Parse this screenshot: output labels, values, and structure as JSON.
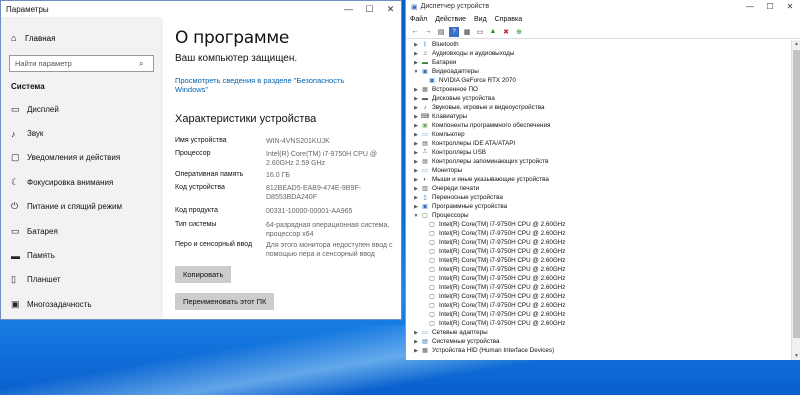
{
  "settings": {
    "window_title": "Параметры",
    "sidebar": {
      "home": "Главная",
      "search_placeholder": "Найти параметр",
      "group": "Система",
      "items": [
        {
          "label": "Дисплей",
          "icon": "display-icon"
        },
        {
          "label": "Звук",
          "icon": "sound-icon"
        },
        {
          "label": "Уведомления и действия",
          "icon": "notifications-icon"
        },
        {
          "label": "Фокусировка внимания",
          "icon": "focus-assist-icon"
        },
        {
          "label": "Питание и спящий режим",
          "icon": "power-icon"
        },
        {
          "label": "Батарея",
          "icon": "battery-icon"
        },
        {
          "label": "Память",
          "icon": "storage-icon"
        },
        {
          "label": "Планшет",
          "icon": "tablet-icon"
        },
        {
          "label": "Многозадачность",
          "icon": "multitasking-icon"
        }
      ]
    },
    "main": {
      "title": "О программе",
      "protected": "Ваш компьютер защищен.",
      "security_link": "Просмотреть сведения в разделе \"Безопасность Windows\"",
      "specs_heading": "Характеристики устройства",
      "specs": {
        "device_name_k": "Имя устройства",
        "device_name_v": "WIN-4VNS201KUJK",
        "cpu_k": "Процессор",
        "cpu_v": "Intel(R) Core(TM) i7-9750H CPU @ 2.60GHz   2.59 GHz",
        "ram_k": "Оперативная память",
        "ram_v": "16.0 ГБ",
        "devid_k": "Код устройства",
        "devid_v": "812BEAD5-EAB9-474E-9B9F-D8553BDA240F",
        "product_k": "Код продукта",
        "product_v": "00331-10000-00001-AA965",
        "systype_k": "Тип системы",
        "systype_v": "64-разрядная операционная система, процессор x64",
        "pen_k": "Перо и сенсорный ввод",
        "pen_v": "Для этого монитора недоступен ввод с помощью пера и сенсорный ввод"
      },
      "copy_button": "Копировать",
      "rename_button": "Переименовать этот ПК"
    }
  },
  "devmgr": {
    "window_title": "Диспетчер устройств",
    "menu": [
      "Файл",
      "Действие",
      "Вид",
      "Справка"
    ],
    "tree": [
      {
        "label": "Bluetooth",
        "arrow": ">",
        "icon": "bluetooth-icon",
        "indent": 0
      },
      {
        "label": "Аудиовходы и аудиовыходы",
        "arrow": ">",
        "icon": "audio-io-icon",
        "indent": 0
      },
      {
        "label": "Батареи",
        "arrow": ">",
        "icon": "battery-icon",
        "indent": 0
      },
      {
        "label": "Видеоадаптеры",
        "arrow": "v",
        "icon": "display-adapter-icon",
        "indent": 0
      },
      {
        "label": "NVIDIA GeForce RTX 2070",
        "arrow": "",
        "icon": "display-adapter-icon",
        "indent": 1
      },
      {
        "label": "Встроенное ПО",
        "arrow": ">",
        "icon": "firmware-icon",
        "indent": 0
      },
      {
        "label": "Дисковые устройства",
        "arrow": ">",
        "icon": "disk-icon",
        "indent": 0
      },
      {
        "label": "Звуковые, игровые и видеоустройства",
        "arrow": ">",
        "icon": "sound-device-icon",
        "indent": 0
      },
      {
        "label": "Клавиатуры",
        "arrow": ">",
        "icon": "keyboard-icon",
        "indent": 0
      },
      {
        "label": "Компоненты программного обеспечения",
        "arrow": ">",
        "icon": "software-component-icon",
        "indent": 0
      },
      {
        "label": "Компьютер",
        "arrow": ">",
        "icon": "computer-icon",
        "indent": 0
      },
      {
        "label": "Контроллеры IDE ATA/ATAPI",
        "arrow": ">",
        "icon": "ide-controller-icon",
        "indent": 0
      },
      {
        "label": "Контроллеры USB",
        "arrow": ">",
        "icon": "usb-icon",
        "indent": 0
      },
      {
        "label": "Контроллеры запоминающих устройств",
        "arrow": ">",
        "icon": "storage-controller-icon",
        "indent": 0
      },
      {
        "label": "Мониторы",
        "arrow": ">",
        "icon": "monitor-icon",
        "indent": 0
      },
      {
        "label": "Мыши и иные указывающие устройства",
        "arrow": ">",
        "icon": "mouse-icon",
        "indent": 0
      },
      {
        "label": "Очереди печати",
        "arrow": ">",
        "icon": "printer-icon",
        "indent": 0
      },
      {
        "label": "Переносные устройства",
        "arrow": ">",
        "icon": "portable-device-icon",
        "indent": 0
      },
      {
        "label": "Программные устройства",
        "arrow": ">",
        "icon": "software-device-icon",
        "indent": 0
      },
      {
        "label": "Процессоры",
        "arrow": "v",
        "icon": "processor-icon",
        "indent": 0
      },
      {
        "label": "Intel(R) Core(TM) i7-9750H CPU @ 2.60GHz",
        "arrow": "",
        "icon": "processor-icon",
        "indent": 1
      },
      {
        "label": "Intel(R) Core(TM) i7-9750H CPU @ 2.60GHz",
        "arrow": "",
        "icon": "processor-icon",
        "indent": 1
      },
      {
        "label": "Intel(R) Core(TM) i7-9750H CPU @ 2.60GHz",
        "arrow": "",
        "icon": "processor-icon",
        "indent": 1
      },
      {
        "label": "Intel(R) Core(TM) i7-9750H CPU @ 2.60GHz",
        "arrow": "",
        "icon": "processor-icon",
        "indent": 1
      },
      {
        "label": "Intel(R) Core(TM) i7-9750H CPU @ 2.60GHz",
        "arrow": "",
        "icon": "processor-icon",
        "indent": 1
      },
      {
        "label": "Intel(R) Core(TM) i7-9750H CPU @ 2.60GHz",
        "arrow": "",
        "icon": "processor-icon",
        "indent": 1
      },
      {
        "label": "Intel(R) Core(TM) i7-9750H CPU @ 2.60GHz",
        "arrow": "",
        "icon": "processor-icon",
        "indent": 1
      },
      {
        "label": "Intel(R) Core(TM) i7-9750H CPU @ 2.60GHz",
        "arrow": "",
        "icon": "processor-icon",
        "indent": 1
      },
      {
        "label": "Intel(R) Core(TM) i7-9750H CPU @ 2.60GHz",
        "arrow": "",
        "icon": "processor-icon",
        "indent": 1
      },
      {
        "label": "Intel(R) Core(TM) i7-9750H CPU @ 2.60GHz",
        "arrow": "",
        "icon": "processor-icon",
        "indent": 1
      },
      {
        "label": "Intel(R) Core(TM) i7-9750H CPU @ 2.60GHz",
        "arrow": "",
        "icon": "processor-icon",
        "indent": 1
      },
      {
        "label": "Intel(R) Core(TM) i7-9750H CPU @ 2.60GHz",
        "arrow": "",
        "icon": "processor-icon",
        "indent": 1
      },
      {
        "label": "Сетевые адаптеры",
        "arrow": ">",
        "icon": "network-adapter-icon",
        "indent": 0
      },
      {
        "label": "Системные устройства",
        "arrow": ">",
        "icon": "system-device-icon",
        "indent": 0
      },
      {
        "label": "Устройства HID (Human Interface Devices)",
        "arrow": ">",
        "icon": "hid-icon",
        "indent": 0
      }
    ]
  },
  "colors": {
    "link": "#0063b1",
    "desktop": "#0b6fd9",
    "sidebar_bg": "#f2f2f2"
  }
}
